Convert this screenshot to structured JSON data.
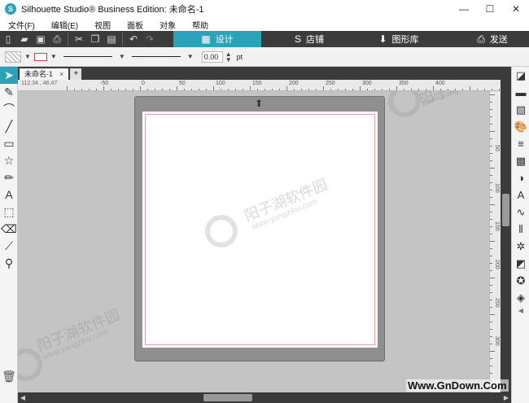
{
  "window": {
    "title": "Silhouette Studio® Business Edition: 未命名-1",
    "logo_glyph": "S",
    "controls": {
      "minimize": "—",
      "maximize": "☐",
      "close": "✕"
    }
  },
  "menu": {
    "items": [
      "文件(F)",
      "编辑(E)",
      "视图",
      "面板",
      "对象",
      "帮助"
    ]
  },
  "toolbar": {
    "tabs": [
      {
        "label": "设计",
        "icon": "grid-icon"
      },
      {
        "label": "店铺",
        "icon": "store-icon"
      },
      {
        "label": "图形库",
        "icon": "library-icon"
      },
      {
        "label": "发送",
        "icon": "send-icon"
      }
    ],
    "active_tab": "设计"
  },
  "properties": {
    "line_width_value": "0.00",
    "line_width_unit": "pt"
  },
  "document": {
    "tab_name": "未命名-1",
    "tab_close": "×",
    "add_tab": "+"
  },
  "ruler": {
    "coordinates": "112.34 , 46.47",
    "h_labels": [
      "-50",
      "0",
      "50",
      "100",
      "150",
      "200",
      "250",
      "300",
      "350",
      "400"
    ],
    "v_labels": [
      "50",
      "100",
      "150",
      "200",
      "250",
      "300"
    ]
  },
  "watermark": {
    "text": "阳子湖软件园",
    "url": "www.yangzihu.com"
  },
  "site_badge": "Www.GnDown.Com",
  "colors": {
    "accent": "#2aa3b8",
    "toolbar_bg": "#3b3b3b",
    "canvas_bg": "#c4c4c4",
    "mat": "#8f8f8f",
    "page_border": "#e7a0a0"
  }
}
